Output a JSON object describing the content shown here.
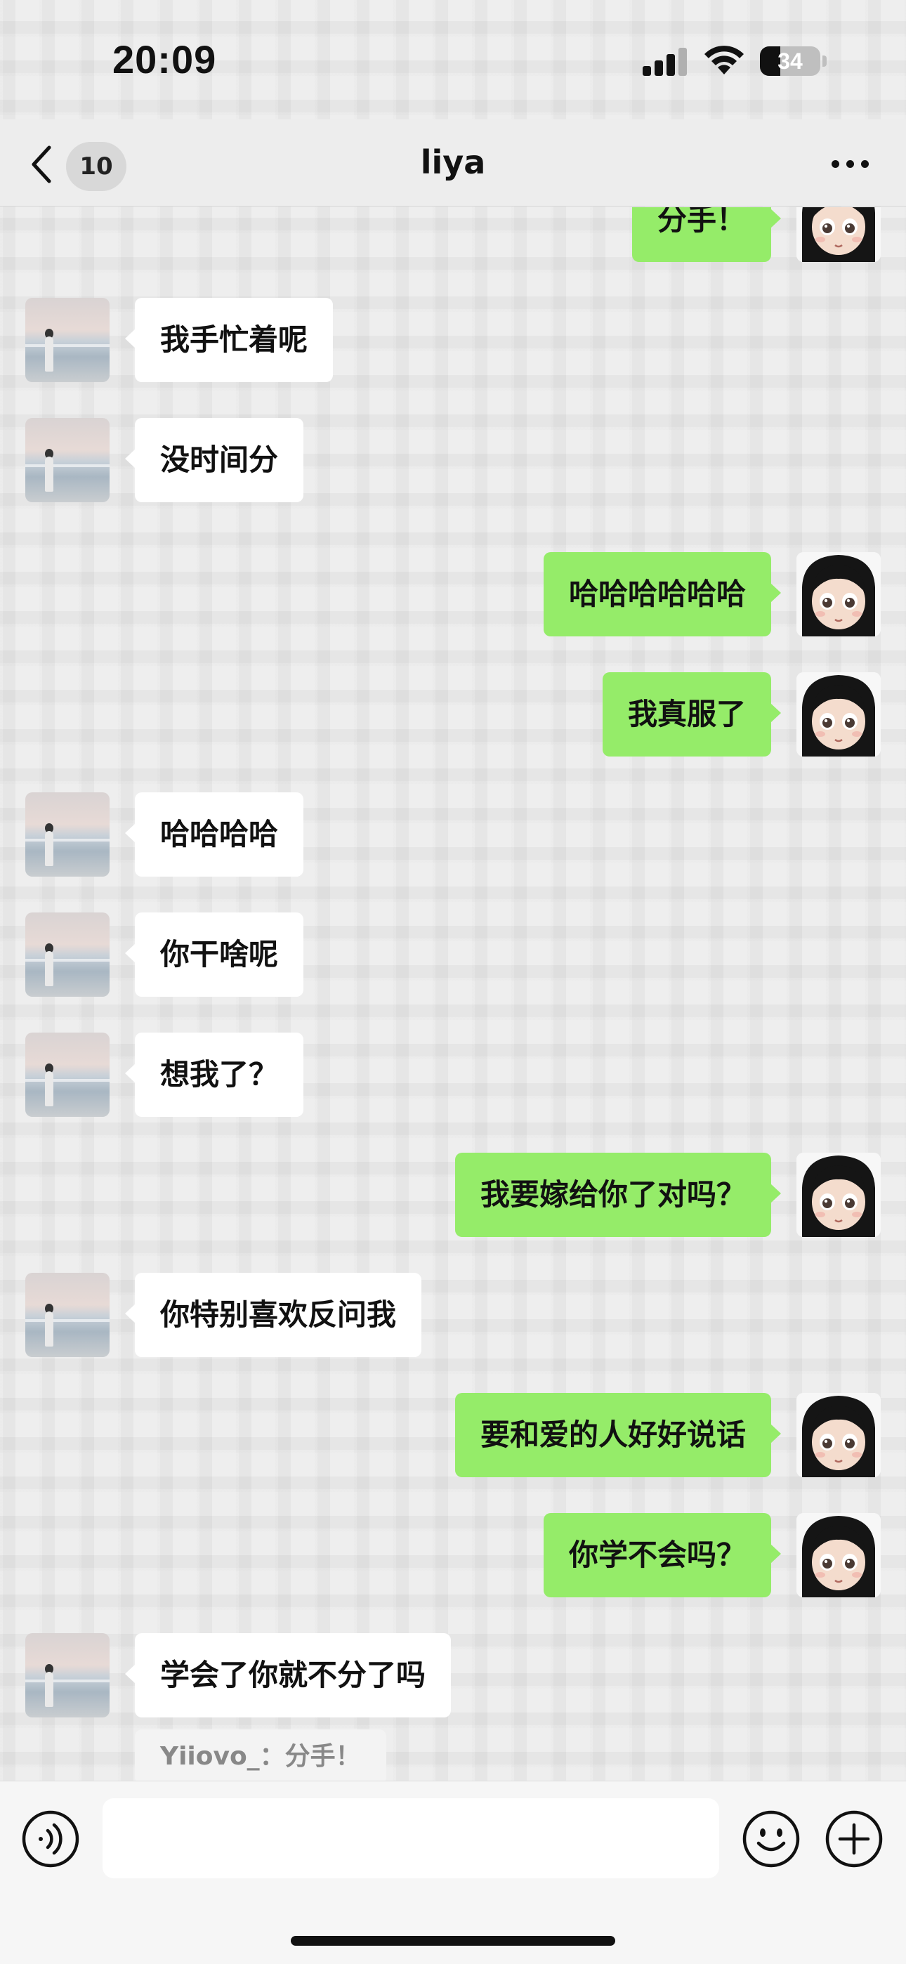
{
  "status_bar": {
    "time": "20:09",
    "battery_level": "34",
    "battery_fraction": 0.34,
    "icons": [
      "signal-icon",
      "wifi-icon",
      "battery-icon"
    ]
  },
  "nav": {
    "back_icon": "chevron-left-icon",
    "unread_count": "10",
    "title": "liya",
    "more_icon": "more-dots-icon"
  },
  "messages": [
    {
      "side": "right",
      "text": "分手！"
    },
    {
      "side": "left",
      "text": "我手忙着呢"
    },
    {
      "side": "left",
      "text": "没时间分"
    },
    {
      "side": "right",
      "text": "哈哈哈哈哈哈"
    },
    {
      "side": "right",
      "text": "我真服了"
    },
    {
      "side": "left",
      "text": "哈哈哈哈"
    },
    {
      "side": "left",
      "text": "你干啥呢"
    },
    {
      "side": "left",
      "text": "想我了？"
    },
    {
      "side": "right",
      "text": "我要嫁给你了对吗？"
    },
    {
      "side": "left",
      "text": "你特别喜欢反问我"
    },
    {
      "side": "right",
      "text": "要和爱的人好好说话"
    },
    {
      "side": "right",
      "text": "你学不会吗？"
    },
    {
      "side": "left",
      "text": "学会了你就不分了吗"
    }
  ],
  "quote": {
    "text": "Yiiovo_：分手！"
  },
  "input_bar": {
    "voice_icon": "voice-icon",
    "message_value": "",
    "emoji_icon": "emoji-icon",
    "plus_icon": "plus-icon"
  },
  "colors": {
    "sent_bubble": "#95ec69",
    "received_bubble": "#ffffff",
    "background": "#ededed"
  }
}
